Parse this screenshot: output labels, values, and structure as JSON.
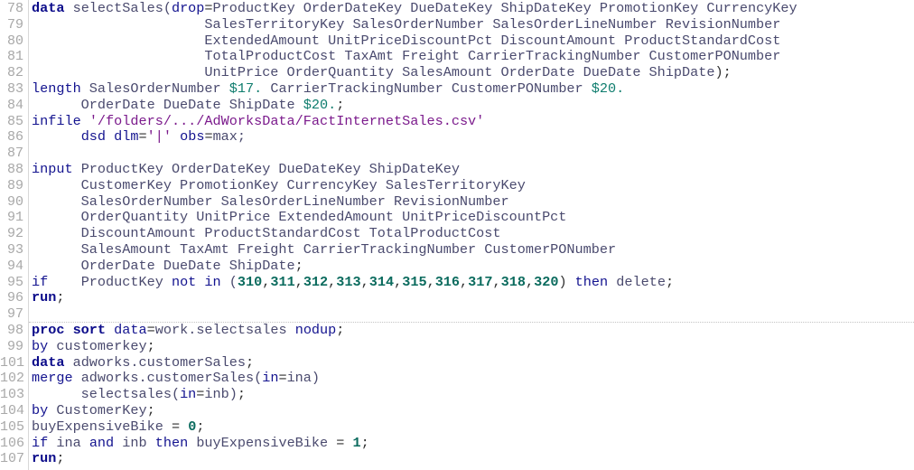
{
  "editor": {
    "language": "SAS",
    "colors": {
      "keyword": "#0b0b8a",
      "option": "#13138f",
      "identifier": "#4a4a6e",
      "format": "#0f7d6e",
      "number": "#0b6b5e",
      "string": "#7b1a8c",
      "line_number": "#a8a8a8"
    },
    "lines": [
      {
        "n": "78",
        "sep": false,
        "t": [
          [
            "kw",
            "data"
          ],
          [
            "tx",
            " selectSales("
          ],
          [
            "k2",
            "drop"
          ],
          [
            "pl",
            "="
          ],
          [
            "tx",
            "ProductKey OrderDateKey DueDateKey ShipDateKey PromotionKey CurrencyKey"
          ]
        ]
      },
      {
        "n": "79",
        "sep": false,
        "t": [
          [
            "tx",
            "                     SalesTerritoryKey SalesOrderNumber SalesOrderLineNumber RevisionNumber"
          ]
        ]
      },
      {
        "n": "80",
        "sep": false,
        "t": [
          [
            "tx",
            "                     ExtendedAmount UnitPriceDiscountPct DiscountAmount ProductStandardCost"
          ]
        ]
      },
      {
        "n": "81",
        "sep": false,
        "t": [
          [
            "tx",
            "                     TotalProductCost TaxAmt Freight CarrierTrackingNumber CustomerPONumber"
          ]
        ]
      },
      {
        "n": "82",
        "sep": false,
        "t": [
          [
            "tx",
            "                     UnitPrice OrderQuantity SalesAmount OrderDate DueDate ShipDate"
          ],
          [
            "pl",
            ");"
          ]
        ]
      },
      {
        "n": "83",
        "sep": false,
        "t": [
          [
            "k2",
            "length"
          ],
          [
            "tx",
            " SalesOrderNumber "
          ],
          [
            "fm",
            "$17."
          ],
          [
            "tx",
            " CarrierTrackingNumber CustomerPONumber "
          ],
          [
            "fm",
            "$20."
          ]
        ]
      },
      {
        "n": "84",
        "sep": false,
        "t": [
          [
            "tx",
            "      OrderDate DueDate ShipDate "
          ],
          [
            "fm",
            "$20."
          ],
          [
            "pl",
            ";"
          ]
        ]
      },
      {
        "n": "85",
        "sep": false,
        "t": [
          [
            "k2",
            "infile"
          ],
          [
            "tx",
            " "
          ],
          [
            "st",
            "'/folders/.../AdWorksData/FactInternetSales.csv'"
          ]
        ]
      },
      {
        "n": "86",
        "sep": false,
        "t": [
          [
            "tx",
            "      "
          ],
          [
            "k2",
            "dsd dlm"
          ],
          [
            "pl",
            "="
          ],
          [
            "st",
            "'|'"
          ],
          [
            "tx",
            " "
          ],
          [
            "k2",
            "obs"
          ],
          [
            "pl",
            "="
          ],
          [
            "tx",
            "max;"
          ]
        ]
      },
      {
        "n": "87",
        "sep": false,
        "t": []
      },
      {
        "n": "88",
        "sep": false,
        "t": [
          [
            "k2",
            "input"
          ],
          [
            "tx",
            " ProductKey OrderDateKey DueDateKey ShipDateKey"
          ]
        ]
      },
      {
        "n": "89",
        "sep": false,
        "t": [
          [
            "tx",
            "      CustomerKey PromotionKey CurrencyKey SalesTerritoryKey"
          ]
        ]
      },
      {
        "n": "90",
        "sep": false,
        "t": [
          [
            "tx",
            "      SalesOrderNumber SalesOrderLineNumber RevisionNumber"
          ]
        ]
      },
      {
        "n": "91",
        "sep": false,
        "t": [
          [
            "tx",
            "      OrderQuantity UnitPrice ExtendedAmount UnitPriceDiscountPct"
          ]
        ]
      },
      {
        "n": "92",
        "sep": false,
        "t": [
          [
            "tx",
            "      DiscountAmount ProductStandardCost TotalProductCost"
          ]
        ]
      },
      {
        "n": "93",
        "sep": false,
        "t": [
          [
            "tx",
            "      SalesAmount TaxAmt Freight CarrierTrackingNumber CustomerPONumber"
          ]
        ]
      },
      {
        "n": "94",
        "sep": false,
        "t": [
          [
            "tx",
            "      OrderDate DueDate ShipDate"
          ],
          [
            "pl",
            ";"
          ]
        ]
      },
      {
        "n": "95",
        "sep": false,
        "t": [
          [
            "k2",
            "if"
          ],
          [
            "tx",
            "    ProductKey "
          ],
          [
            "k2",
            "not in"
          ],
          [
            "tx",
            " ("
          ],
          [
            "nm",
            "310"
          ],
          [
            "pl",
            ","
          ],
          [
            "nm",
            "311"
          ],
          [
            "pl",
            ","
          ],
          [
            "nm",
            "312"
          ],
          [
            "pl",
            ","
          ],
          [
            "nm",
            "313"
          ],
          [
            "pl",
            ","
          ],
          [
            "nm",
            "314"
          ],
          [
            "pl",
            ","
          ],
          [
            "nm",
            "315"
          ],
          [
            "pl",
            ","
          ],
          [
            "nm",
            "316"
          ],
          [
            "pl",
            ","
          ],
          [
            "nm",
            "317"
          ],
          [
            "pl",
            ","
          ],
          [
            "nm",
            "318"
          ],
          [
            "pl",
            ","
          ],
          [
            "nm",
            "320"
          ],
          [
            "pl",
            ") "
          ],
          [
            "k2",
            "then"
          ],
          [
            "tx",
            " delete"
          ],
          [
            "pl",
            ";"
          ]
        ]
      },
      {
        "n": "96",
        "sep": false,
        "t": [
          [
            "kw",
            "run"
          ],
          [
            "pl",
            ";"
          ]
        ]
      },
      {
        "n": "97",
        "sep": false,
        "t": []
      },
      {
        "n": "98",
        "sep": true,
        "t": [
          [
            "kw",
            "proc sort"
          ],
          [
            "tx",
            " "
          ],
          [
            "k2",
            "data"
          ],
          [
            "pl",
            "="
          ],
          [
            "tx",
            "work.selectsales "
          ],
          [
            "k2",
            "nodup"
          ],
          [
            "pl",
            ";"
          ]
        ]
      },
      {
        "n": "99",
        "sep": false,
        "t": [
          [
            "k2",
            "by"
          ],
          [
            "tx",
            " customerkey"
          ],
          [
            "pl",
            ";"
          ]
        ]
      },
      {
        "n": "101",
        "sep": false,
        "t": [
          [
            "kw",
            "data"
          ],
          [
            "tx",
            " adworks.customerSales"
          ],
          [
            "pl",
            ";"
          ]
        ]
      },
      {
        "n": "102",
        "sep": false,
        "t": [
          [
            "k2",
            "merge"
          ],
          [
            "tx",
            " adworks.customerSales("
          ],
          [
            "k2",
            "in"
          ],
          [
            "pl",
            "="
          ],
          [
            "tx",
            "ina)"
          ]
        ]
      },
      {
        "n": "103",
        "sep": false,
        "t": [
          [
            "tx",
            "      selectsales("
          ],
          [
            "k2",
            "in"
          ],
          [
            "pl",
            "="
          ],
          [
            "tx",
            "inb)"
          ],
          [
            "pl",
            ";"
          ]
        ]
      },
      {
        "n": "104",
        "sep": false,
        "t": [
          [
            "k2",
            "by"
          ],
          [
            "tx",
            " CustomerKey"
          ],
          [
            "pl",
            ";"
          ]
        ]
      },
      {
        "n": "105",
        "sep": false,
        "t": [
          [
            "tx",
            "buyExpensiveBike "
          ],
          [
            "pl",
            "= "
          ],
          [
            "nm",
            "0"
          ],
          [
            "pl",
            ";"
          ]
        ]
      },
      {
        "n": "106",
        "sep": false,
        "t": [
          [
            "k2",
            "if"
          ],
          [
            "tx",
            " ina "
          ],
          [
            "k2",
            "and"
          ],
          [
            "tx",
            " inb "
          ],
          [
            "k2",
            "then"
          ],
          [
            "tx",
            " buyExpensiveBike "
          ],
          [
            "pl",
            "= "
          ],
          [
            "nm",
            "1"
          ],
          [
            "pl",
            ";"
          ]
        ]
      },
      {
        "n": "107",
        "sep": false,
        "t": [
          [
            "kw",
            "run"
          ],
          [
            "pl",
            ";"
          ]
        ]
      }
    ]
  }
}
